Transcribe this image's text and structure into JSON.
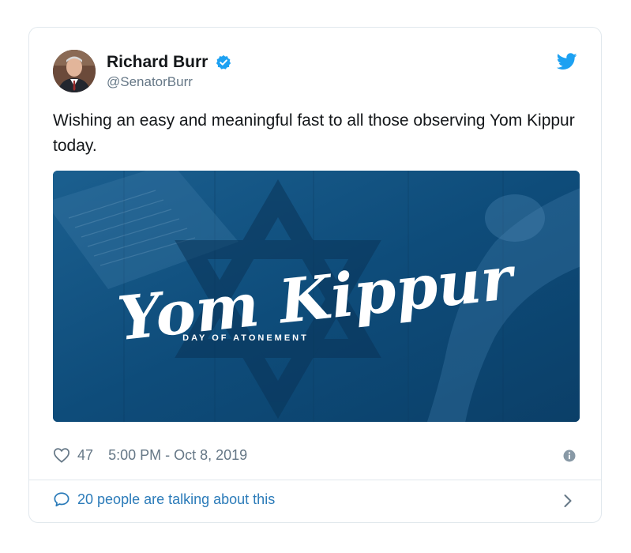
{
  "author": {
    "display_name": "Richard Burr",
    "handle": "@SenatorBurr",
    "verified": true
  },
  "tweet": {
    "text": "Wishing an easy and meaningful fast to all those observing Yom Kippur today."
  },
  "media": {
    "title": "Yom Kippur",
    "subtitle": "DAY OF ATONEMENT"
  },
  "meta": {
    "likes": "47",
    "timestamp": "5:00 PM - Oct 8, 2019"
  },
  "footer": {
    "talking": "20 people are talking about this"
  },
  "icons": {
    "brand": "twitter-bird-icon",
    "verified": "verified-badge-icon",
    "like": "heart-icon",
    "info": "info-icon",
    "reply": "speech-bubble-icon",
    "more": "chevron-right-icon"
  },
  "colors": {
    "twitter_blue": "#1da1f2",
    "link_blue": "#2b7bb9",
    "muted": "#657786",
    "media_bg": "#0f4f7e"
  }
}
